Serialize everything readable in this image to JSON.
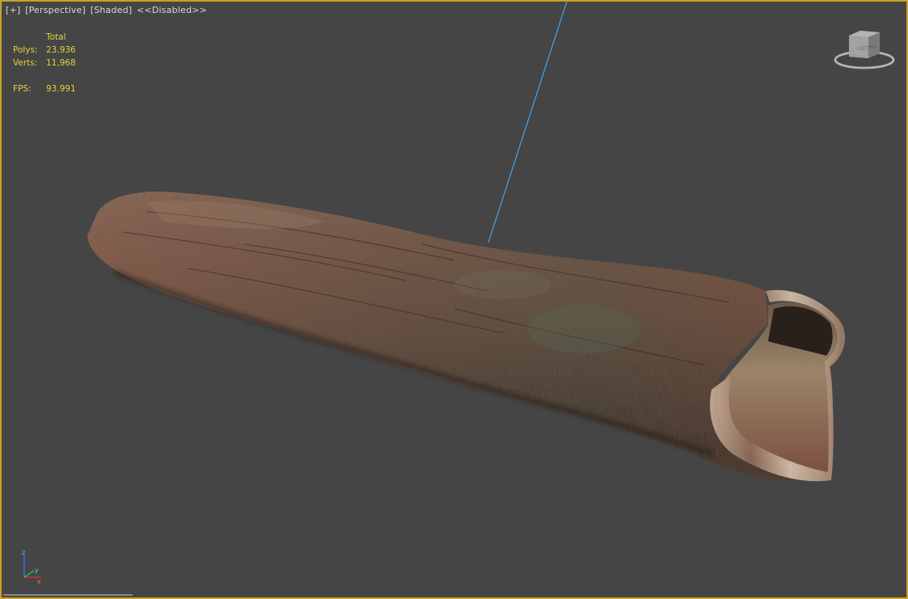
{
  "viewport": {
    "labels": {
      "plus": "[+]",
      "view": "[Perspective]",
      "shading": "[Shaded]",
      "status": "<<Disabled>>"
    },
    "stats": {
      "header": "Total",
      "polys_label": "Polys:",
      "polys_value": "23,936",
      "verts_label": "Verts:",
      "verts_value": "11,968",
      "fps_label": "FPS:",
      "fps_value": "93.991"
    },
    "viewcube": {
      "face_label": "TOP",
      "side_label": "LEFT"
    },
    "axis": {
      "z": "z",
      "y": "y",
      "x": "x"
    }
  },
  "colors": {
    "viewport_bg": "#454545",
    "active_border": "#c9a227",
    "stats_text": "#e6d23a",
    "label_text": "#d8d8d8",
    "light_line": "#4aa3e8"
  }
}
